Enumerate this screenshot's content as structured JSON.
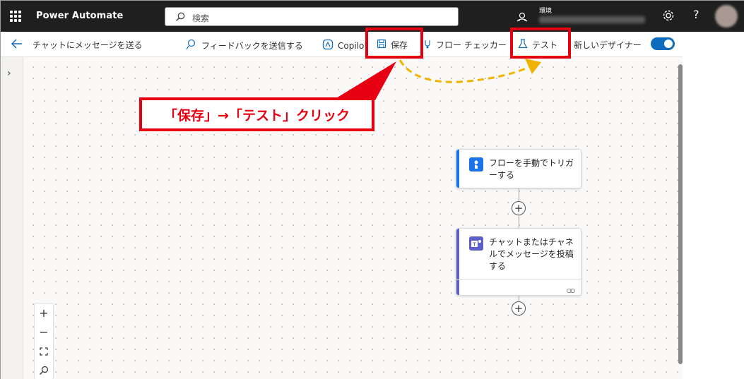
{
  "header": {
    "app_title": "Power Automate",
    "search_placeholder": "検索",
    "environment_label": "環境",
    "help_label": "?"
  },
  "cmdbar": {
    "flow_name": "チャットにメッセージを送る",
    "feedback": "フィードバックを送信する",
    "copilot": "Copilot",
    "save": "保存",
    "flow_checker": "フロー チェッカー",
    "test": "テスト",
    "new_designer": "新しいデザイナー",
    "new_designer_on": true
  },
  "canvas": {
    "trigger_card": "フローを手動でトリガーする",
    "action_card": "チャットまたはチャネルでメッセージを投稿する"
  },
  "zoom": {
    "zoom_in": "+",
    "zoom_out": "−"
  },
  "annotation": {
    "callout_text": "「保存」→「テスト」クリック",
    "color": "#e60012",
    "arrow_color": "#f0b400"
  },
  "colors": {
    "header_bg": "#1f1f1f",
    "accent": "#0f6cbd",
    "trigger_bar": "#1a73e8",
    "teams_bar": "#5b5fc7"
  }
}
